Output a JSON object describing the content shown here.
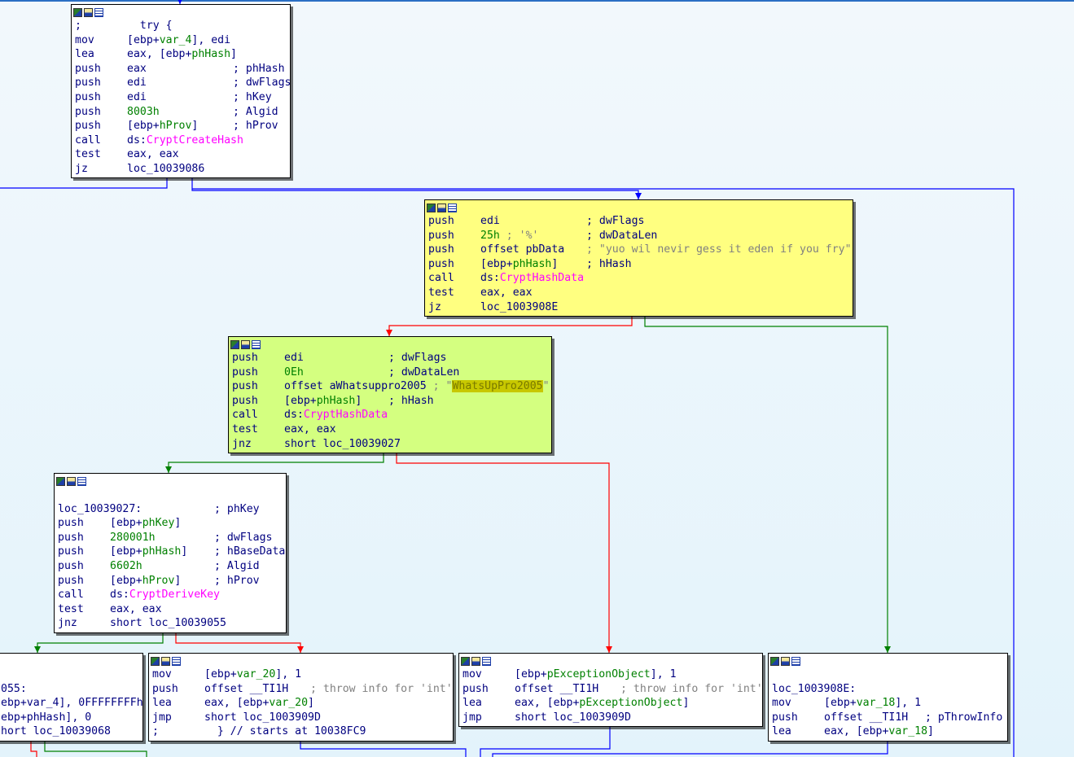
{
  "graph": {
    "blocks": [
      {
        "id": "b1",
        "color": "white",
        "lines": [
          {
            "m": ";",
            "o": [
              [
                "  try {",
                "n"
              ]
            ],
            "c": []
          },
          {
            "m": "mov",
            "o": [
              [
                "[ebp+",
                "n"
              ],
              [
                "var_4",
                "g"
              ],
              [
                "], edi",
                "n"
              ]
            ],
            "c": []
          },
          {
            "m": "lea",
            "o": [
              [
                "eax, [ebp+",
                "n"
              ],
              [
                "phHash",
                "g"
              ],
              [
                "]",
                "n"
              ]
            ],
            "c": []
          },
          {
            "m": "push",
            "o": [
              [
                "eax",
                "n"
              ]
            ],
            "c": [
              [
                "; phHash",
                "n"
              ]
            ]
          },
          {
            "m": "push",
            "o": [
              [
                "edi",
                "n"
              ]
            ],
            "c": [
              [
                "; dwFlags",
                "n"
              ]
            ]
          },
          {
            "m": "push",
            "o": [
              [
                "edi",
                "n"
              ]
            ],
            "c": [
              [
                "; hKey",
                "n"
              ]
            ]
          },
          {
            "m": "push",
            "o": [
              [
                "8003h",
                "g"
              ]
            ],
            "c": [
              [
                "; Algid",
                "n"
              ]
            ]
          },
          {
            "m": "push",
            "o": [
              [
                "[ebp+",
                "n"
              ],
              [
                "hProv",
                "g"
              ],
              [
                "]",
                "n"
              ]
            ],
            "c": [
              [
                "; hProv",
                "n"
              ]
            ]
          },
          {
            "m": "call",
            "o": [
              [
                "ds:",
                "n"
              ],
              [
                "CryptCreateHash",
                "p"
              ]
            ],
            "c": []
          },
          {
            "m": "test",
            "o": [
              [
                "eax, eax",
                "n"
              ]
            ],
            "c": []
          },
          {
            "m": "jz",
            "o": [
              [
                "loc_10039086",
                "n"
              ]
            ],
            "c": []
          }
        ]
      },
      {
        "id": "b2",
        "color": "yellow",
        "lines": [
          {
            "m": "push",
            "o": [
              [
                "edi",
                "n"
              ]
            ],
            "c": [
              [
                "; dwFlags",
                "n"
              ]
            ]
          },
          {
            "m": "push",
            "o": [
              [
                "25h",
                "g"
              ],
              [
                " ; '%'",
                "gr"
              ]
            ],
            "c": [
              [
                "; dwDataLen",
                "n"
              ]
            ]
          },
          {
            "m": "push",
            "o": [
              [
                "offset pbData",
                "n"
              ]
            ],
            "c": [
              [
                "; \"yuo wil nevir gess it eden if you fry\"",
                "gr"
              ]
            ]
          },
          {
            "m": "push",
            "o": [
              [
                "[ebp+",
                "n"
              ],
              [
                "phHash",
                "g"
              ],
              [
                "]",
                "n"
              ]
            ],
            "c": [
              [
                "; hHash",
                "n"
              ]
            ]
          },
          {
            "m": "call",
            "o": [
              [
                "ds:",
                "n"
              ],
              [
                "CryptHashData",
                "p"
              ]
            ],
            "c": []
          },
          {
            "m": "test",
            "o": [
              [
                "eax, eax",
                "n"
              ]
            ],
            "c": []
          },
          {
            "m": "jz",
            "o": [
              [
                "loc_1003908E",
                "n"
              ]
            ],
            "c": []
          }
        ]
      },
      {
        "id": "b3",
        "color": "green",
        "lines": [
          {
            "m": "push",
            "o": [
              [
                "edi",
                "n"
              ]
            ],
            "c": [
              [
                "; dwFlags",
                "n"
              ]
            ]
          },
          {
            "m": "push",
            "o": [
              [
                "0Eh",
                "g"
              ]
            ],
            "c": [
              [
                "; dwDataLen",
                "n"
              ]
            ]
          },
          {
            "m": "push",
            "o": [
              [
                "offset aWhatsuppro2005",
                "n"
              ],
              [
                " ; \"",
                "gr"
              ],
              [
                "WhatsUpPro2005",
                "hl"
              ],
              [
                "\"",
                "gr"
              ]
            ],
            "c": []
          },
          {
            "m": "push",
            "o": [
              [
                "[ebp+",
                "n"
              ],
              [
                "phHash",
                "g"
              ],
              [
                "]",
                "n"
              ]
            ],
            "c": [
              [
                "; hHash",
                "n"
              ]
            ]
          },
          {
            "m": "call",
            "o": [
              [
                "ds:",
                "n"
              ],
              [
                "CryptHashData",
                "p"
              ]
            ],
            "c": []
          },
          {
            "m": "test",
            "o": [
              [
                "eax, eax",
                "n"
              ]
            ],
            "c": []
          },
          {
            "m": "jnz",
            "o": [
              [
                "short loc_10039027",
                "n"
              ]
            ],
            "c": []
          }
        ]
      },
      {
        "id": "b4",
        "color": "white",
        "lines": [
          {
            "m": "",
            "o": [],
            "c": []
          },
          {
            "m": "loc_10039027:",
            "o": [],
            "c": [
              [
                "; phKey",
                "n"
              ]
            ]
          },
          {
            "m": "push",
            "o": [
              [
                "[ebp+",
                "n"
              ],
              [
                "phKey",
                "g"
              ],
              [
                "]",
                "n"
              ]
            ],
            "c": []
          },
          {
            "m": "push",
            "o": [
              [
                "280001h",
                "g"
              ]
            ],
            "c": [
              [
                "; dwFlags",
                "n"
              ]
            ]
          },
          {
            "m": "push",
            "o": [
              [
                "[ebp+",
                "n"
              ],
              [
                "phHash",
                "g"
              ],
              [
                "]",
                "n"
              ]
            ],
            "c": [
              [
                "; hBaseData",
                "n"
              ]
            ]
          },
          {
            "m": "push",
            "o": [
              [
                "6602h",
                "g"
              ]
            ],
            "c": [
              [
                "; Algid",
                "n"
              ]
            ]
          },
          {
            "m": "push",
            "o": [
              [
                "[ebp+",
                "n"
              ],
              [
                "hProv",
                "g"
              ],
              [
                "]",
                "n"
              ]
            ],
            "c": [
              [
                "; hProv",
                "n"
              ]
            ]
          },
          {
            "m": "call",
            "o": [
              [
                "ds:",
                "n"
              ],
              [
                "CryptDeriveKey",
                "p"
              ]
            ],
            "c": []
          },
          {
            "m": "test",
            "o": [
              [
                "eax, eax",
                "n"
              ]
            ],
            "c": []
          },
          {
            "m": "jnz",
            "o": [
              [
                "short loc_10039055",
                "n"
              ]
            ],
            "c": []
          }
        ]
      },
      {
        "id": "b5",
        "color": "white",
        "lines": [
          {
            "m": "",
            "o": [],
            "c": []
          },
          {
            "m": "055:",
            "o": [],
            "c": []
          },
          {
            "m": "ebp+var_4], 0FFFFFFFFh",
            "o": [],
            "c": []
          },
          {
            "m": "ebp+phHash], 0",
            "o": [],
            "c": []
          },
          {
            "m": "hort loc_10039068",
            "o": [],
            "c": []
          }
        ]
      },
      {
        "id": "b6",
        "color": "white",
        "lines": [
          {
            "m": "mov",
            "o": [
              [
                "[ebp+",
                "n"
              ],
              [
                "var_20",
                "g"
              ],
              [
                "], 1",
                "n"
              ]
            ],
            "c": []
          },
          {
            "m": "push",
            "o": [
              [
                "offset __TI1H",
                "n"
              ]
            ],
            "c": [
              [
                "; throw info for 'int'",
                "gr"
              ]
            ]
          },
          {
            "m": "lea",
            "o": [
              [
                "eax, [ebp+",
                "n"
              ],
              [
                "var_20",
                "g"
              ],
              [
                "]",
                "n"
              ]
            ],
            "c": []
          },
          {
            "m": "jmp",
            "o": [
              [
                "short loc_1003909D",
                "n"
              ]
            ],
            "c": []
          },
          {
            "m": ";",
            "o": [
              [
                "  } // starts at 10038FC9",
                "n"
              ]
            ],
            "c": []
          }
        ]
      },
      {
        "id": "b7",
        "color": "white",
        "lines": [
          {
            "m": "mov",
            "o": [
              [
                "[ebp+",
                "n"
              ],
              [
                "pExceptionObject",
                "g"
              ],
              [
                "], 1",
                "n"
              ]
            ],
            "c": []
          },
          {
            "m": "push",
            "o": [
              [
                "offset __TI1H",
                "n"
              ]
            ],
            "c": [
              [
                "; throw info for 'int'",
                "gr"
              ]
            ]
          },
          {
            "m": "lea",
            "o": [
              [
                "eax, [ebp+",
                "n"
              ],
              [
                "pExceptionObject",
                "g"
              ],
              [
                "]",
                "n"
              ]
            ],
            "c": []
          },
          {
            "m": "jmp",
            "o": [
              [
                "short loc_1003909D",
                "n"
              ]
            ],
            "c": []
          }
        ]
      },
      {
        "id": "b8",
        "color": "white",
        "lines": [
          {
            "m": "",
            "o": [],
            "c": []
          },
          {
            "m": "loc_1003908E:",
            "o": [],
            "c": []
          },
          {
            "m": "mov",
            "o": [
              [
                "[ebp+",
                "n"
              ],
              [
                "var_18",
                "g"
              ],
              [
                "], 1",
                "n"
              ]
            ],
            "c": []
          },
          {
            "m": "push",
            "o": [
              [
                "offset __TI1H",
                "n"
              ]
            ],
            "c": [
              [
                "; pThrowInfo",
                "n"
              ]
            ]
          },
          {
            "m": "lea",
            "o": [
              [
                "eax, [ebp+",
                "n"
              ],
              [
                "var_18",
                "g"
              ],
              [
                "]",
                "n"
              ]
            ],
            "c": []
          }
        ]
      }
    ],
    "colors": {
      "edge_true": "#008000",
      "edge_false": "#ff0000",
      "edge_uncond": "#0000ff",
      "block_yellow": "#ffff80",
      "block_green": "#d4ff80"
    },
    "header_icons": [
      "graph-color-icon",
      "edit-comment-icon",
      "list-view-icon"
    ]
  }
}
